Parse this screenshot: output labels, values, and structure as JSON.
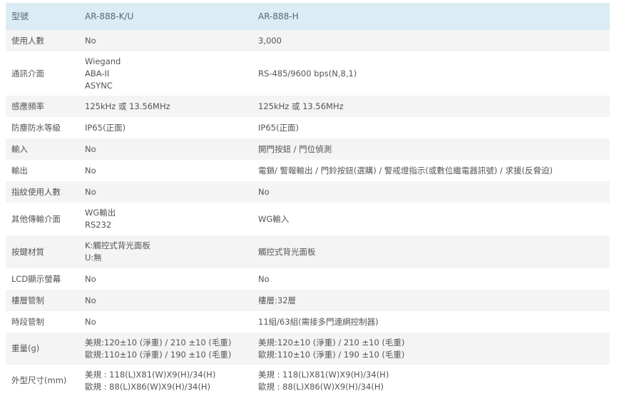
{
  "header": {
    "label": "型號",
    "model_a": "AR-888-K/U",
    "model_b": "AR-888-H"
  },
  "rows": [
    {
      "label": "使用人數",
      "a": [
        "No"
      ],
      "b": [
        "3,000"
      ]
    },
    {
      "label": "通訊介面",
      "a": [
        "Wiegand",
        "ABA-II",
        "ASYNC"
      ],
      "b": [
        "RS-485/9600 bps(N,8,1)"
      ]
    },
    {
      "label": "感應頻率",
      "a": [
        "125kHz 或 13.56MHz"
      ],
      "b": [
        "125kHz 或 13.56MHz"
      ]
    },
    {
      "label": "防塵防水等級",
      "a": [
        "IP65(正面)"
      ],
      "b": [
        "IP65(正面)"
      ]
    },
    {
      "label": "輸入",
      "a": [
        "No"
      ],
      "b": [
        "開門按鈕 / 門位偵測"
      ]
    },
    {
      "label": "輸出",
      "a": [
        "No"
      ],
      "b": [
        "電鎖/ 警報輸出 / 門鈴按鈕(選購) / 警戒燈指示(或數位繼電器訊號) / 求援(反脅迫)"
      ]
    },
    {
      "label": "指紋使用人數",
      "a": [
        "No"
      ],
      "b": [
        "No"
      ]
    },
    {
      "label": "其他傳輸介面",
      "a": [
        "WG輸出",
        "RS232"
      ],
      "b": [
        "WG輸入"
      ]
    },
    {
      "label": "按鍵材質",
      "a": [
        "K:觸控式背光面板",
        "U:無"
      ],
      "b": [
        "觸控式背光面板"
      ]
    },
    {
      "label": "LCD顯示螢幕",
      "a": [
        "No"
      ],
      "b": [
        "No"
      ]
    },
    {
      "label": "樓層管制",
      "a": [
        "No"
      ],
      "b": [
        "樓層:32層"
      ]
    },
    {
      "label": "時段管制",
      "a": [
        "No"
      ],
      "b": [
        "11組/63組(需接多門連網控制器)"
      ]
    },
    {
      "label": "重量(g)",
      "a": [
        "美規:120±10 (淨重) / 210 ±10 (毛重)",
        "歐規:110±10 (淨重) / 190 ±10 (毛重)"
      ],
      "b": [
        "美規:120±10 (淨重) / 210 ±10 (毛重)",
        "歐規:110±10 (淨重) / 190 ±10 (毛重)"
      ]
    },
    {
      "label": "外型尺寸(mm)",
      "a": [
        "美規 : 118(L)X81(W)X9(H)/34(H)",
        "歐規 : 88(L)X86(W)X9(H)/34(H)"
      ],
      "b": [
        "美規 : 118(L)X81(W)X9(H)/34(H)",
        "歐規 : 88(L)X86(W)X9(H)/34(H)"
      ]
    }
  ]
}
